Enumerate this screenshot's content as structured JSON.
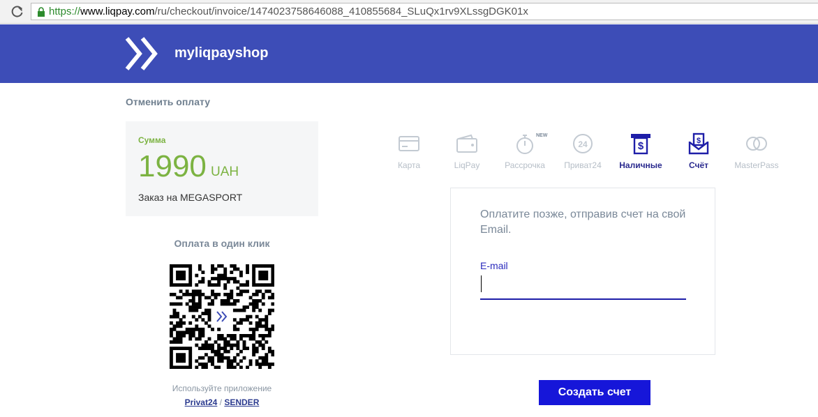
{
  "browser": {
    "url_scheme": "https://",
    "url_host": "www.liqpay.com",
    "url_path": "/ru/checkout/invoice/1474023758646088_410855684_SLuQx1rv9XLssgDGK01x"
  },
  "header": {
    "shop_name": "myliqpayshop",
    "background": "#3d4db7"
  },
  "cancel_label": "Отменить оплату",
  "amount": {
    "label": "Сумма",
    "value": "1990",
    "currency": "UAH",
    "order_description": "Заказ на MEGASPORT",
    "accent": "#7cb342"
  },
  "oneclick": {
    "title": "Оплата в один клик",
    "hint": "Используйте приложение",
    "link_privat": "Privat24",
    "separator": " / ",
    "link_sender": "SENDER"
  },
  "methods": [
    {
      "label": "Карта",
      "icon": "card-icon",
      "active": false
    },
    {
      "label": "LiqPay",
      "icon": "wallet-icon",
      "active": false
    },
    {
      "label": "Рассрочка",
      "icon": "stopwatch-icon",
      "active": false,
      "badge": "NEW"
    },
    {
      "label": "Приват24",
      "icon": "privat24-icon",
      "active": false
    },
    {
      "label": "Наличные",
      "icon": "cash-terminal-icon",
      "active": true
    },
    {
      "label": "Счёт",
      "icon": "invoice-envelope-icon",
      "active": true
    },
    {
      "label": "MasterPass",
      "icon": "masterpass-icon",
      "active": false
    }
  ],
  "invoice": {
    "text": "Оплатите позже, отправив счет на свой Email.",
    "email_label": "E-mail",
    "email_value": "",
    "submit_label": "Создать счет"
  }
}
